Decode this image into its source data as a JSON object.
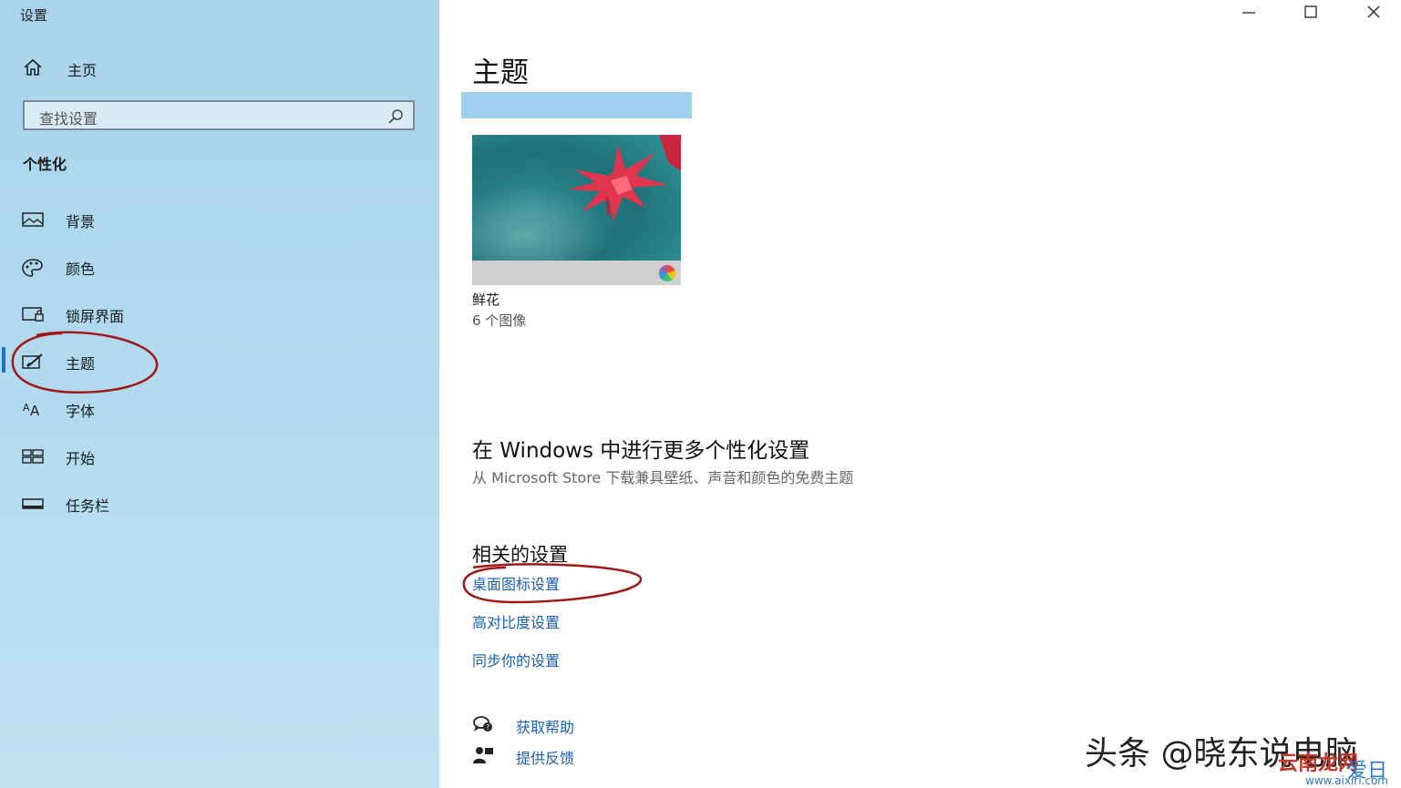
{
  "window": {
    "title": "设置",
    "minimize_icon": "minimize-icon",
    "maximize_icon": "maximize-icon",
    "close_icon": "close-icon"
  },
  "sidebar": {
    "home_label": "主页",
    "search_placeholder": "查找设置",
    "section_title": "个性化",
    "items": [
      {
        "label": "背景",
        "icon": "picture-icon"
      },
      {
        "label": "颜色",
        "icon": "palette-icon"
      },
      {
        "label": "锁屏界面",
        "icon": "lock-screen-icon"
      },
      {
        "label": "主题",
        "icon": "theme-brush-icon",
        "active": true
      },
      {
        "label": "字体",
        "icon": "font-icon"
      },
      {
        "label": "开始",
        "icon": "start-tiles-icon"
      },
      {
        "label": "任务栏",
        "icon": "taskbar-icon"
      }
    ],
    "accent_color": "#1a73c8"
  },
  "main": {
    "title": "主题",
    "theme_card": {
      "name": "鲜花",
      "count": "6 个图像"
    },
    "more_heading": "在 Windows 中进行更多个性化设置",
    "more_sub": "从 Microsoft Store 下载兼具壁纸、声音和颜色的免费主题",
    "related_heading": "相关的设置",
    "related_links": [
      "桌面图标设置",
      "高对比度设置",
      "同步你的设置"
    ],
    "help": {
      "get_help": "获取帮助",
      "feedback": "提供反馈"
    },
    "link_color": "#1a5fb4"
  },
  "watermarks": {
    "author": "头条 @晓东说电脑",
    "site_name": "云南龙网",
    "site_suffix": "爱日",
    "site_url": "www.aixiri.com"
  },
  "annotation_color": "#a01818"
}
